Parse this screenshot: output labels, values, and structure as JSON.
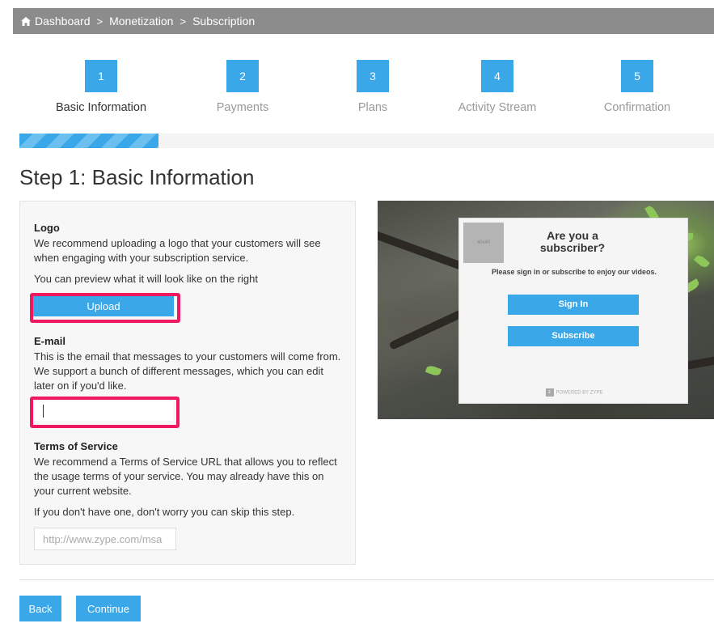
{
  "breadcrumb": {
    "items": [
      "Dashboard",
      "Monetization",
      "Subscription"
    ],
    "separator": ">"
  },
  "steps": [
    {
      "number": "1",
      "label": "Basic Information",
      "active": true
    },
    {
      "number": "2",
      "label": "Payments",
      "active": false
    },
    {
      "number": "3",
      "label": "Plans",
      "active": false
    },
    {
      "number": "4",
      "label": "Activity Stream",
      "active": false
    },
    {
      "number": "5",
      "label": "Confirmation",
      "active": false
    }
  ],
  "progress": {
    "fraction": 0.2
  },
  "page_title": "Step 1: Basic Information",
  "form": {
    "logo": {
      "title": "Logo",
      "description": "We recommend uploading a logo that your customers will see when engaging with your subscription service.",
      "note": "You can preview what it will look like on the right",
      "upload_label": "Upload"
    },
    "email": {
      "title": "E-mail",
      "description": "This is the email that messages to your customers will come from. We support a bunch of different messages, which you can edit later on if you'd like.",
      "value": ""
    },
    "tos": {
      "title": "Terms of Service",
      "description": "We recommend a Terms of Service URL that allows you to reflect the usage terms of your service. You may already have this on your current website.",
      "note": "If you don't have one, don't worry you can skip this step.",
      "placeholder": "http://www.zype.com/msa"
    }
  },
  "preview": {
    "logo_placeholder": "40x40",
    "title": "Are you a subscriber?",
    "subtitle": "Please sign in or subscribe to enjoy our videos.",
    "sign_in_label": "Sign In",
    "subscribe_label": "Subscribe",
    "powered_by": "POWERED BY ZYPE"
  },
  "actions": {
    "back_label": "Back",
    "continue_label": "Continue"
  },
  "colors": {
    "accent": "#3aa7e8",
    "highlight": "#f0185f",
    "breadcrumb_bg": "#8c8c8c"
  }
}
